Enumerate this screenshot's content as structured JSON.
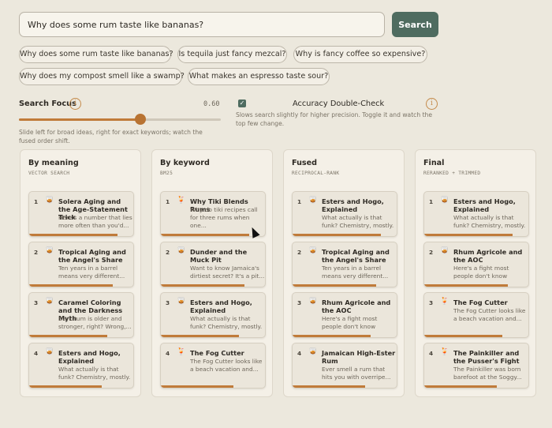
{
  "search": {
    "query": "Why does some rum taste like bananas?",
    "button_label": "Search"
  },
  "chips": [
    "Why does some rum taste like bananas?",
    "Is tequila just fancy mezcal?",
    "Why is fancy coffee so expensive?",
    "Why does my compost smell like a swamp?",
    "What makes an espresso taste sour?"
  ],
  "focus": {
    "label": "Search Focus",
    "value_text": "0.60",
    "value": 0.6,
    "help": "Slide left for broad ideas, right for exact keywords; watch the fused order shift."
  },
  "accuracy": {
    "label": "Accuracy Double-Check",
    "checked": true,
    "help": "Slows search slightly for higher precision. Toggle it and watch the top few change."
  },
  "columns": [
    {
      "title": "By meaning",
      "subtitle": "VECTOR SEARCH",
      "cards": [
        {
          "rank": "1",
          "icon": "rum-glass-icon",
          "title": "Solera Aging and the Age-Statement Trick",
          "snippet": "Here's a number that lies more often than you'd...",
          "score": 0.85
        },
        {
          "rank": "2",
          "icon": "rum-glass-icon",
          "title": "Tropical Aging and the Angel's Share",
          "snippet": "Ten years in a barrel means very different...",
          "score": 0.8
        },
        {
          "rank": "3",
          "icon": "rum-glass-icon",
          "title": "Caramel Coloring and the Darkness Myth",
          "snippet": "Dark rum is older and stronger, right? Wrong,...",
          "score": 0.75
        },
        {
          "rank": "4",
          "icon": "rum-glass-icon",
          "title": "Esters and Hogo, Explained",
          "snippet": "What actually is that funk? Chemistry, mostly. An...",
          "score": 0.7
        }
      ]
    },
    {
      "title": "By keyword",
      "subtitle": "BM25",
      "cards": [
        {
          "rank": "1",
          "icon": "tiki-cocktail-icon",
          "title": "Why Tiki Blends Rums",
          "snippet": "Why do tiki recipes call for three rums when one...",
          "score": 0.85
        },
        {
          "rank": "2",
          "icon": "rum-glass-icon",
          "title": "Dunder and the Muck Pit",
          "snippet": "Want to know Jamaica's dirtiest secret? It's a pit...",
          "score": 0.8
        },
        {
          "rank": "3",
          "icon": "rum-glass-icon",
          "title": "Esters and Hogo, Explained",
          "snippet": "What actually is that funk? Chemistry, mostly. An...",
          "score": 0.75
        },
        {
          "rank": "4",
          "icon": "tiki-cocktail-icon",
          "title": "The Fog Cutter",
          "snippet": "The Fog Cutter looks like a beach vacation and...",
          "score": 0.7
        }
      ]
    },
    {
      "title": "Fused",
      "subtitle": "RECIPROCAL-RANK",
      "cards": [
        {
          "rank": "1",
          "icon": "rum-glass-icon",
          "title": "Esters and Hogo, Explained",
          "snippet": "What actually is that funk? Chemistry, mostly. An...",
          "score": 0.85
        },
        {
          "rank": "2",
          "icon": "rum-glass-icon",
          "title": "Tropical Aging and the Angel's Share",
          "snippet": "Ten years in a barrel means very different...",
          "score": 0.8
        },
        {
          "rank": "3",
          "icon": "rum-glass-icon",
          "title": "Rhum Agricole and the AOC",
          "snippet": "Here's a fight most people don't know they're...",
          "score": 0.75
        },
        {
          "rank": "4",
          "icon": "rum-glass-icon",
          "title": "Jamaican High-Ester Rum",
          "snippet": "Ever smell a rum that hits you with overripe...",
          "score": 0.7
        }
      ]
    },
    {
      "title": "Final",
      "subtitle": "RERANKED + TRIMMED",
      "cards": [
        {
          "rank": "1",
          "icon": "rum-glass-icon",
          "title": "Esters and Hogo, Explained",
          "snippet": "What actually is that funk? Chemistry, mostly. An...",
          "score": 0.85
        },
        {
          "rank": "2",
          "icon": "rum-glass-icon",
          "title": "Rhum Agricole and the AOC",
          "snippet": "Here's a fight most people don't know they're...",
          "score": 0.8
        },
        {
          "rank": "3",
          "icon": "tiki-cocktail-icon",
          "title": "The Fog Cutter",
          "snippet": "The Fog Cutter looks like a beach vacation and...",
          "score": 0.75
        },
        {
          "rank": "4",
          "icon": "tiki-cocktail-icon",
          "title": "The Painkiller and the Pusser's Fight",
          "snippet": "The Painkiller was born barefoot at the Soggy...",
          "score": 0.7
        }
      ]
    }
  ]
}
